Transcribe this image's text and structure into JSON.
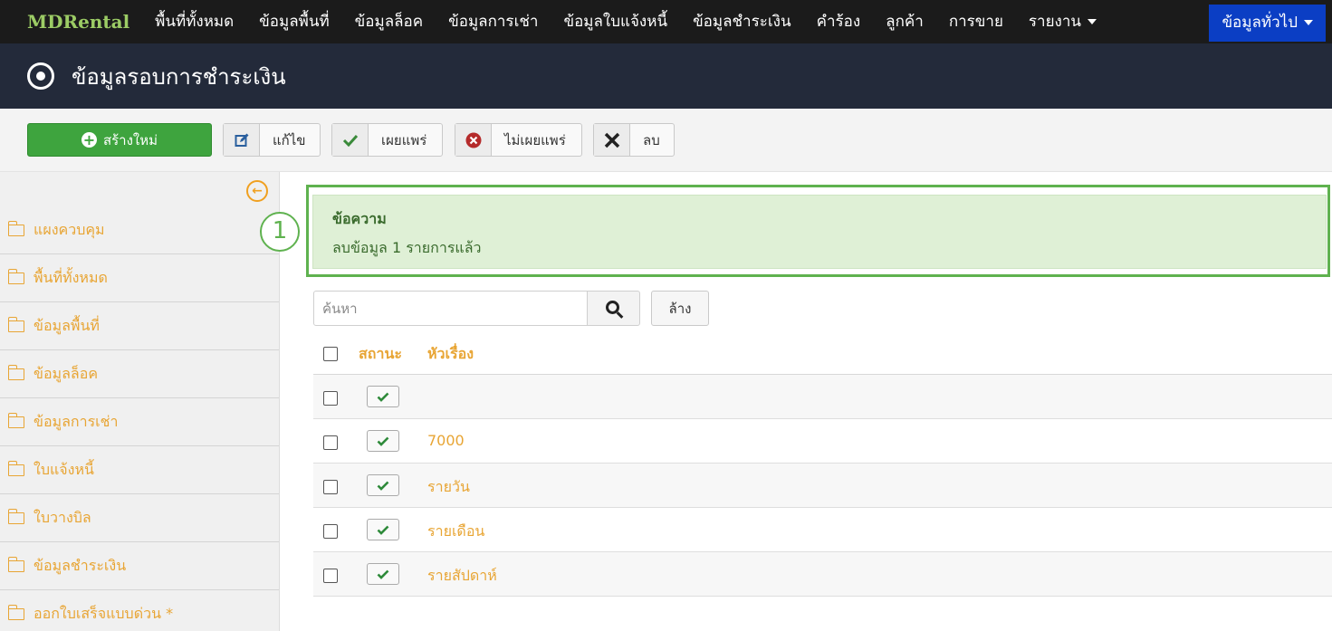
{
  "brand": "MDRental",
  "nav": {
    "items": [
      "พื้นที่ทั้งหมด",
      "ข้อมูลพื้นที่",
      "ข้อมูลล็อค",
      "ข้อมูลการเช่า",
      "ข้อมูลใบแจ้งหนี้",
      "ข้อมูลชำระเงิน",
      "คำร้อง",
      "ลูกค้า",
      "การขาย",
      "รายงาน"
    ],
    "active": "ข้อมูลทั่วไป"
  },
  "page": {
    "title": "ข้อมูลรอบการชำระเงิน"
  },
  "toolbar": {
    "new_label": "สร้างใหม่",
    "edit_label": "แก้ไข",
    "publish_label": "เผยแพร่",
    "unpublish_label": "ไม่เผยแพร่",
    "delete_label": "ลบ"
  },
  "sidebar": {
    "items": [
      "แผงควบคุม",
      "พื้นที่ทั้งหมด",
      "ข้อมูลพื้นที่",
      "ข้อมูลล็อค",
      "ข้อมูลการเช่า",
      "ใบแจ้งหนี้",
      "ใบวางบิล",
      "ข้อมูลชำระเงิน",
      "ออกใบเสร็จแบบด่วน *"
    ]
  },
  "alert": {
    "title": "ข้อความ",
    "text": "ลบข้อมูล 1 รายการแล้ว",
    "step": "1"
  },
  "search": {
    "placeholder": "ค้นหา",
    "value": "",
    "clear_label": "ล้าง"
  },
  "table": {
    "headers": {
      "status": "สถานะ",
      "title": "หัวเรื่อง"
    },
    "rows": [
      {
        "title": ""
      },
      {
        "title": "7000"
      },
      {
        "title": "รายวัน"
      },
      {
        "title": "รายเดือน"
      },
      {
        "title": "รายสัปดาห์"
      }
    ]
  },
  "colors": {
    "accent": "#e8a534",
    "primary_green": "#3ea43e",
    "nav_active": "#0b3ec4",
    "header_bg": "#232a3a"
  }
}
